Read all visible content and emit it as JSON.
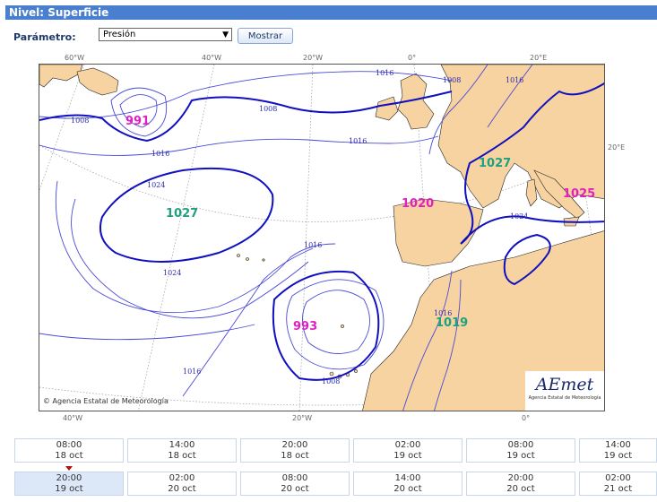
{
  "header": {
    "title": "Nivel: Superficie"
  },
  "controls": {
    "param_label": "Parámetro:",
    "param_selected": "Presión",
    "show_button": "Mostrar"
  },
  "map": {
    "lon_top": [
      "60°W",
      "40°W",
      "20°W",
      "0°",
      "20°E"
    ],
    "lon_bottom": [
      "40°W",
      "20°W",
      "0°"
    ],
    "lat_right": "20°E",
    "pressure_centers": [
      {
        "label": "991",
        "color": "#e020c0"
      },
      {
        "label": "1027",
        "color": "#20a080"
      },
      {
        "label": "993",
        "color": "#e020c0"
      },
      {
        "label": "1020",
        "color": "#e020c0"
      },
      {
        "label": "1027",
        "color": "#20a080"
      },
      {
        "label": "1025",
        "color": "#e020c0"
      },
      {
        "label": "1019",
        "color": "#20a080"
      }
    ],
    "isobar_labels": [
      "1008",
      "1008",
      "1016",
      "1016",
      "1024",
      "1024",
      "1016",
      "1016",
      "1008",
      "1016",
      "1024",
      "1008",
      "1016",
      "1016"
    ],
    "copyright": "Agencia Estatal de Meteorología",
    "logo_text": "AEmet",
    "logo_sub": "Agencia Estatal de Meteorología",
    "colors": {
      "land": "#f6d3a0",
      "isobar": "#4a4ad8",
      "isobar_bold": "#1010c0",
      "sea": "#ffffff"
    }
  },
  "timeline": {
    "row1": [
      {
        "time": "08:00",
        "date": "18 oct"
      },
      {
        "time": "14:00",
        "date": "18 oct"
      },
      {
        "time": "20:00",
        "date": "18 oct"
      },
      {
        "time": "02:00",
        "date": "19 oct"
      },
      {
        "time": "08:00",
        "date": "19 oct"
      },
      {
        "time": "14:00",
        "date": "19 oct"
      }
    ],
    "row2": [
      {
        "time": "20:00",
        "date": "19 oct"
      },
      {
        "time": "02:00",
        "date": "20 oct"
      },
      {
        "time": "08:00",
        "date": "20 oct"
      },
      {
        "time": "14:00",
        "date": "20 oct"
      },
      {
        "time": "20:00",
        "date": "20 oct"
      },
      {
        "time": "02:00",
        "date": "21 oct"
      }
    ]
  }
}
